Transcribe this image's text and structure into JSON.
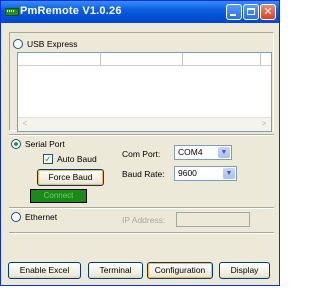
{
  "window": {
    "title": "PmRemote  V1.0.26"
  },
  "usb": {
    "label": "USB Express",
    "selected": false
  },
  "serial": {
    "label": "Serial Port",
    "selected": true,
    "auto_baud_label": "Auto Baud",
    "auto_baud_checked": true,
    "force_baud_label": "Force Baud",
    "connect_label": "Connect",
    "com_port_label": "Com Port:",
    "com_port_value": "COM4",
    "baud_rate_label": "Baud Rate:",
    "baud_rate_value": "9600"
  },
  "ethernet": {
    "label": "Ethernet",
    "selected": false,
    "ip_label": "IP Address:",
    "ip_value": ""
  },
  "buttons": {
    "enable_excel": "Enable Excel",
    "terminal": "Terminal",
    "configuration": "Configuration",
    "display": "Display"
  },
  "icons": {
    "app": "terminal-icon",
    "minimize": "minimize-icon",
    "maximize": "maximize-icon",
    "close": "close-icon",
    "scroll_left": "arrow-left-icon",
    "scroll_right": "arrow-right-icon",
    "dropdown": "chevron-down-icon"
  },
  "colors": {
    "title_bar": "#0a5fe0",
    "connect_bg": "#1b8a1b",
    "connect_text": "#6ad06a",
    "check": "#21a121"
  }
}
